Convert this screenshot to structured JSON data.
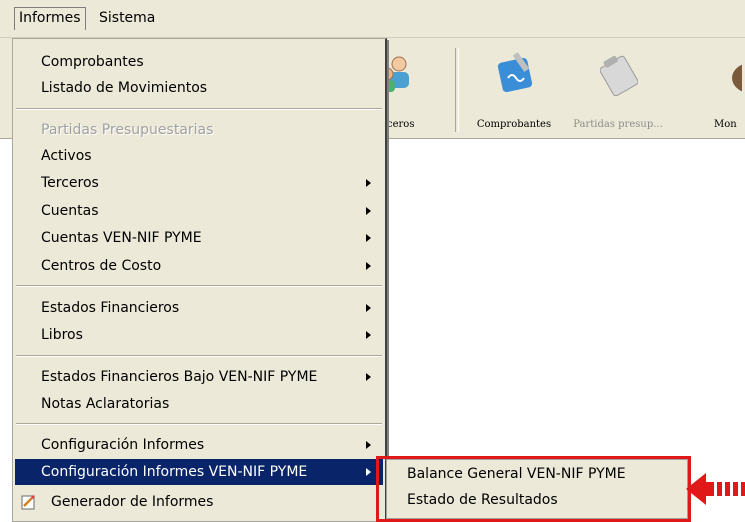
{
  "menubar": {
    "informes": "Informes",
    "sistema": "Sistema"
  },
  "toolbar": {
    "terceros_partial": "ceros",
    "comprobantes": "Comprobantes",
    "partidas": "Partidas presup...",
    "mon_partial": "Mon"
  },
  "menu": {
    "comprobantes": "Comprobantes",
    "listado": "Listado de Movimientos",
    "partidas": "Partidas Presupuestarias",
    "activos": "Activos",
    "terceros": "Terceros",
    "cuentas": "Cuentas",
    "cuentas_ven": "Cuentas VEN-NIF PYME",
    "centros": "Centros de Costo",
    "estados": "Estados Financieros",
    "libros": "Libros",
    "estados_ven": "Estados Financieros Bajo VEN-NIF PYME",
    "notas": "Notas Aclaratorias",
    "config": "Configuración Informes",
    "config_ven": "Configuración Informes VEN-NIF PYME",
    "generador": "Generador de Informes"
  },
  "submenu": {
    "balance": "Balance General VEN-NIF PYME",
    "estado": "Estado de Resultados"
  },
  "colors": {
    "highlight": "#0a246a",
    "annotation": "#e01818"
  }
}
